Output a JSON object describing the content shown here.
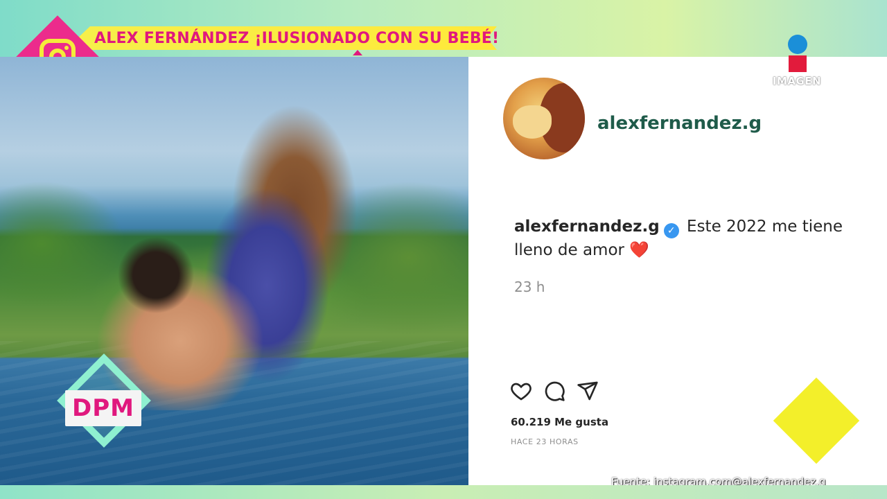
{
  "headline": "ALEX FERNÁNDEZ ¡ILUSIONADO CON SU BEBÉ!",
  "show_badge": "DPM",
  "channel_logo": "IMAGEN",
  "post": {
    "username": "alexfernandez.g",
    "caption_user": "alexfernandez.g",
    "caption_text": "Este 2022 me tiene lleno de amor",
    "caption_emoji": "❤️",
    "time_ago": "23 h",
    "likes": "60.219 Me gusta",
    "posted_label": "HACE 23 HORAS"
  },
  "source": "Fuente: instagram.com@alexfernandez.g",
  "colors": {
    "headline_text": "#e0187e",
    "banner": "#f6ef4a",
    "instagram_badge": "#ec2b8c",
    "username": "#1f5b4a",
    "verified": "#3897f0"
  },
  "icons": [
    "instagram-icon",
    "heart-icon",
    "comment-icon",
    "share-icon",
    "verified-icon"
  ]
}
